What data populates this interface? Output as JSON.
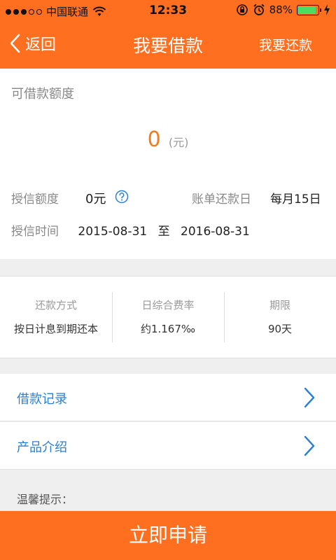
{
  "status_bar": {
    "carrier": "中国联通",
    "time": "12:33",
    "battery_text": "88%",
    "battery_fraction": 0.88
  },
  "nav": {
    "back_label": "返回",
    "title": "我要借款",
    "right_label": "我要还款"
  },
  "quota": {
    "label": "可借款额度",
    "amount": "0",
    "unit": "(元)",
    "credit_label": "授信额度",
    "credit_value": "0元",
    "bill_label": "账单还款日",
    "bill_value": "每月15日",
    "time_label": "授信时间",
    "start_date": "2015-08-31",
    "to_text": "至",
    "end_date": "2016-08-31"
  },
  "terms": [
    {
      "label": "还款方式",
      "value": "按日计息到期还本"
    },
    {
      "label": "日综合费率",
      "value": "约1.167‰"
    },
    {
      "label": "期限",
      "value": "90天"
    }
  ],
  "menu": {
    "loan_records": "借款记录",
    "product_intro": "产品介绍"
  },
  "tips_label": "温馨提示：",
  "apply_button": "立即申请",
  "colors": {
    "brand_orange": "#ff6f1f",
    "amount_orange": "#f47b20",
    "link_blue": "#2a7fd4"
  }
}
